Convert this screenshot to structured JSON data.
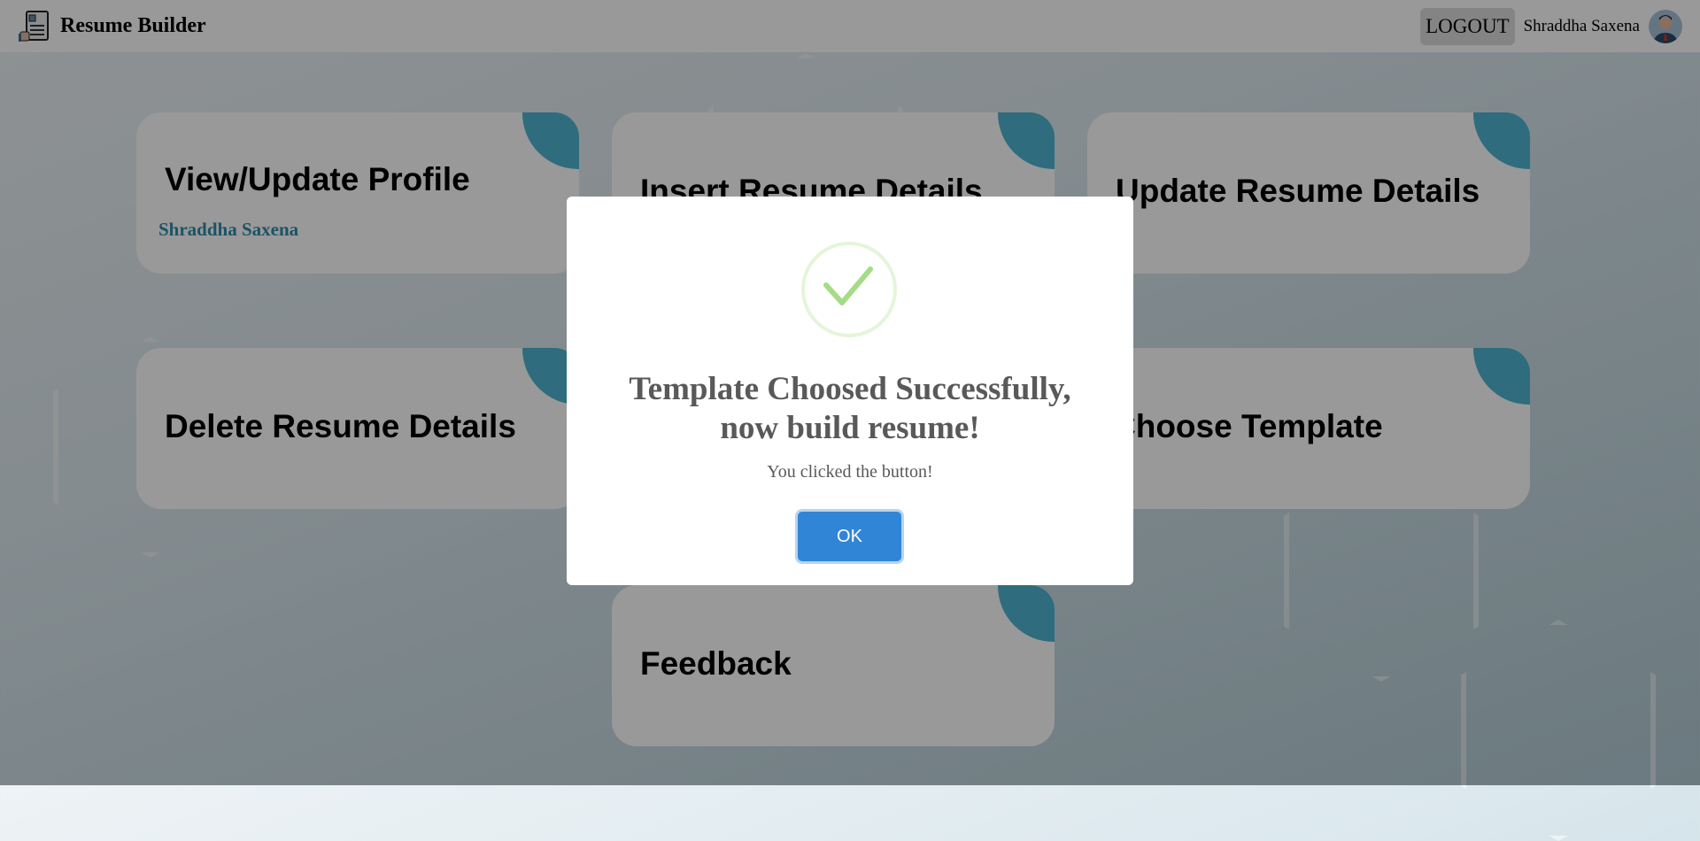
{
  "header": {
    "brand": "Resume Builder",
    "logout": "LOGOUT",
    "user_name": "Shraddha Saxena"
  },
  "cards": [
    {
      "title": "View/Update Profile",
      "subtitle": "Shraddha Saxena"
    },
    {
      "title": "Insert Resume Details"
    },
    {
      "title": "Update Resume Details"
    },
    {
      "title": "Delete Resume Details"
    },
    {
      "title": "Choose Template"
    },
    {
      "title": "Feedback"
    }
  ],
  "modal": {
    "title": "Template Choosed Successfully, now build resume!",
    "text": "You clicked the button!",
    "ok": "OK"
  },
  "colors": {
    "accent": "#4db5d3",
    "ok_button": "#3085d6",
    "check": "#a5dc86"
  }
}
